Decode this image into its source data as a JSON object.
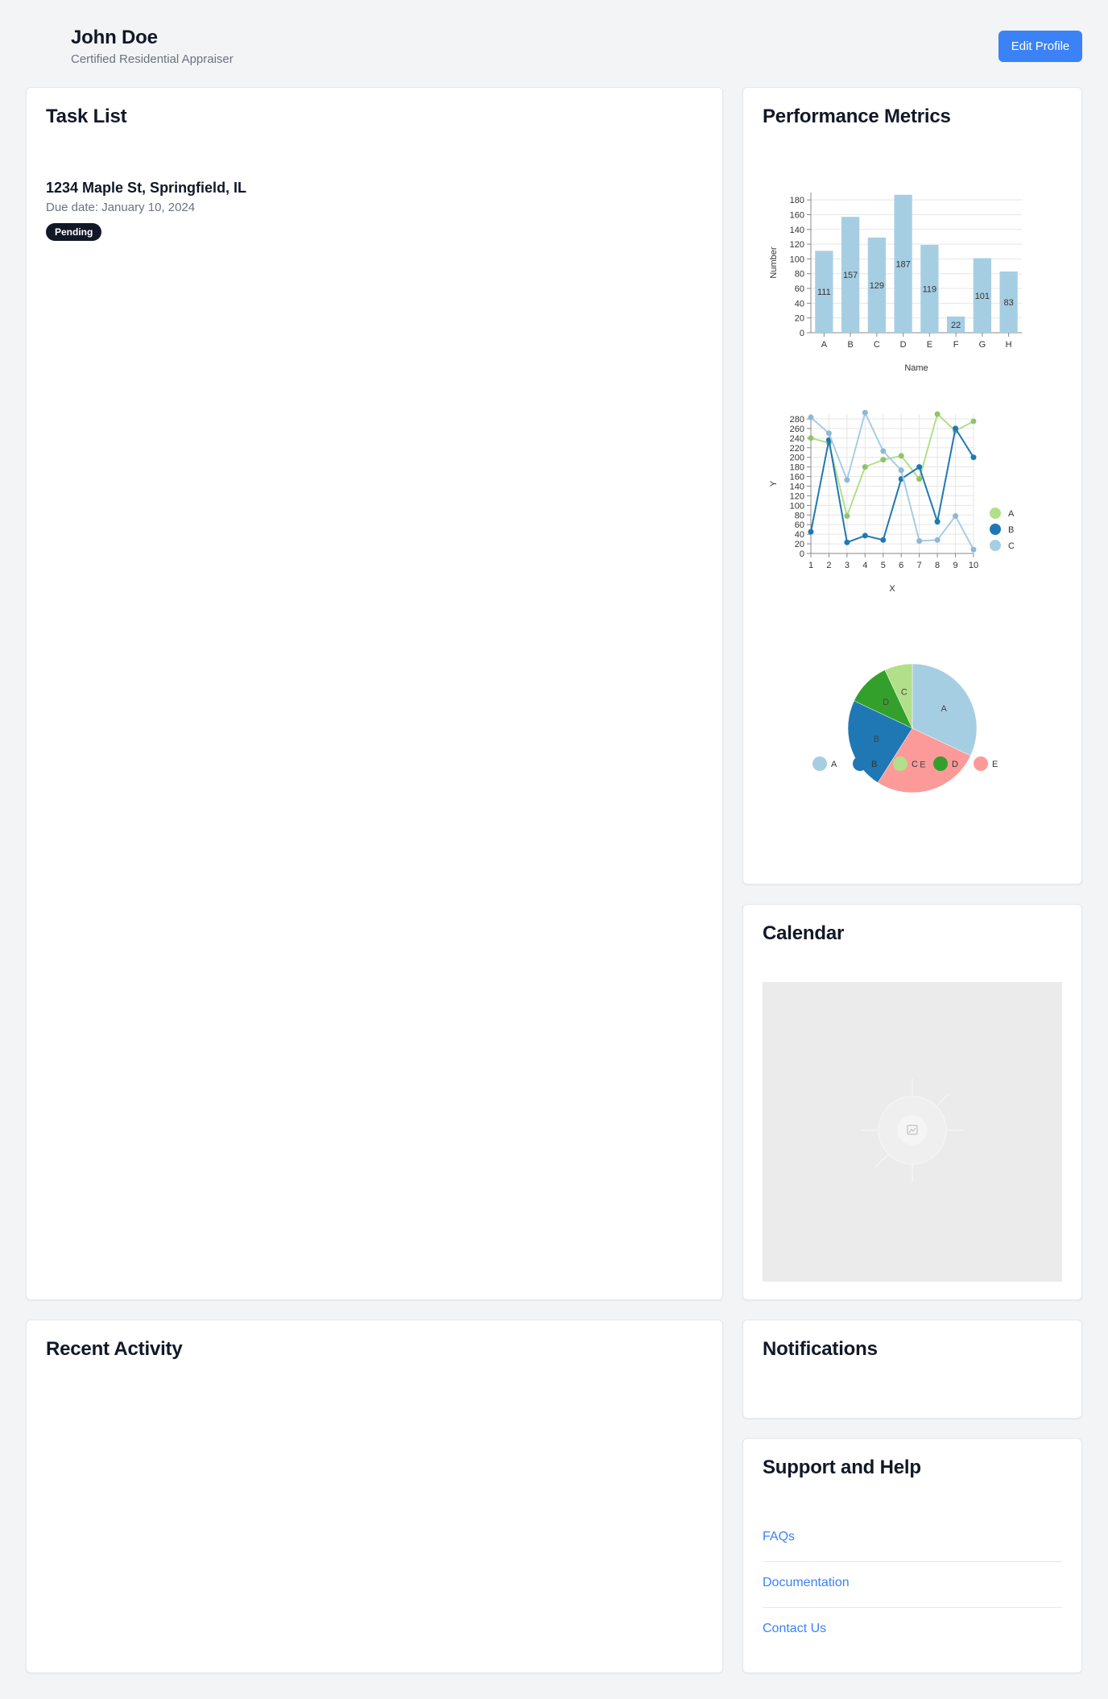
{
  "profile": {
    "name": "John Doe",
    "title": "Certified Residential Appraiser",
    "edit_button": "Edit Profile"
  },
  "tasks": {
    "title": "Task List",
    "items": [
      {
        "address": "1234 Maple St, Springfield, IL",
        "due": "Due date: January 10, 2024",
        "status": "Pending"
      }
    ]
  },
  "metrics": {
    "title": "Performance Metrics"
  },
  "calendar": {
    "title": "Calendar",
    "image_icon": "image-placeholder-icon"
  },
  "activity": {
    "title": "Recent Activity"
  },
  "notifications": {
    "title": "Notifications"
  },
  "support": {
    "title": "Support and Help",
    "links": [
      "FAQs",
      "Documentation",
      "Contact Us"
    ]
  },
  "colors": {
    "accent": "#3b82f6",
    "light_blue": "#a6cee3",
    "dark_blue": "#1f78b4",
    "light_green": "#b2df8a",
    "dark_green": "#33a02c",
    "pink": "#fb9a99"
  },
  "chart_data": [
    {
      "type": "bar",
      "categories": [
        "A",
        "B",
        "C",
        "D",
        "E",
        "F",
        "G",
        "H"
      ],
      "values": [
        111,
        157,
        129,
        187,
        119,
        22,
        101,
        83
      ],
      "xlabel": "Name",
      "ylabel": "Number",
      "ylim": [
        0,
        190
      ],
      "yticks": [
        0,
        20,
        40,
        60,
        80,
        100,
        120,
        140,
        160,
        180
      ],
      "grid": true,
      "data_labels": true
    },
    {
      "type": "line",
      "x": [
        1,
        2,
        3,
        4,
        5,
        6,
        7,
        8,
        9,
        10
      ],
      "series": [
        {
          "name": "A",
          "values": [
            240,
            230,
            78,
            180,
            195,
            203,
            155,
            290,
            255,
            275
          ]
        },
        {
          "name": "B",
          "values": [
            45,
            236,
            23,
            37,
            28,
            155,
            180,
            66,
            260,
            200
          ]
        },
        {
          "name": "C",
          "values": [
            283,
            250,
            153,
            293,
            213,
            173,
            26,
            28,
            78,
            8
          ]
        }
      ],
      "xlabel": "X",
      "ylabel": "Y",
      "ylim": [
        0,
        290
      ],
      "yticks": [
        0,
        20,
        40,
        60,
        80,
        100,
        120,
        140,
        160,
        180,
        200,
        220,
        240,
        260,
        280
      ],
      "grid": true,
      "legend": "right"
    },
    {
      "type": "pie",
      "slices": [
        {
          "label": "A",
          "value": 32
        },
        {
          "label": "B",
          "value": 23
        },
        {
          "label": "C",
          "value": 7
        },
        {
          "label": "D",
          "value": 11
        },
        {
          "label": "E",
          "value": 27
        }
      ],
      "legend": "bottom"
    }
  ]
}
